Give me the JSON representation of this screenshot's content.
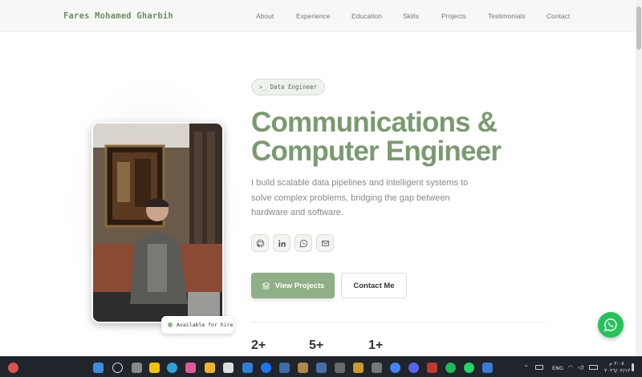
{
  "header": {
    "brand": "Fares Mohamed Gharbih",
    "nav": [
      "About",
      "Experience",
      "Education",
      "Skills",
      "Projects",
      "Testimonials",
      "Contact"
    ]
  },
  "hero": {
    "role_icon": ">_",
    "role": "Data Engineer",
    "title_line1": "Communications &",
    "title_line2": "Computer Engineer",
    "description": "I build scalable data pipelines and intelligent systems to solve complex problems, bridging the gap between hardware and software.",
    "social": [
      "github-icon",
      "linkedin-icon",
      "whatsapp-icon",
      "mail-icon"
    ],
    "primary_button": "View Projects",
    "secondary_button": "Contact Me",
    "availability": "Available for hire",
    "stats": [
      "2+",
      "5+",
      "1+"
    ]
  },
  "taskbar": {
    "language": "ENG",
    "time": "٢:٠٨ م",
    "date": "٢٠٢٦/٠٢/١٢"
  },
  "colors": {
    "accent": "#7a9a70",
    "button": "#8faf86",
    "whatsapp": "#25c25a",
    "taskbar": "#20242b"
  }
}
